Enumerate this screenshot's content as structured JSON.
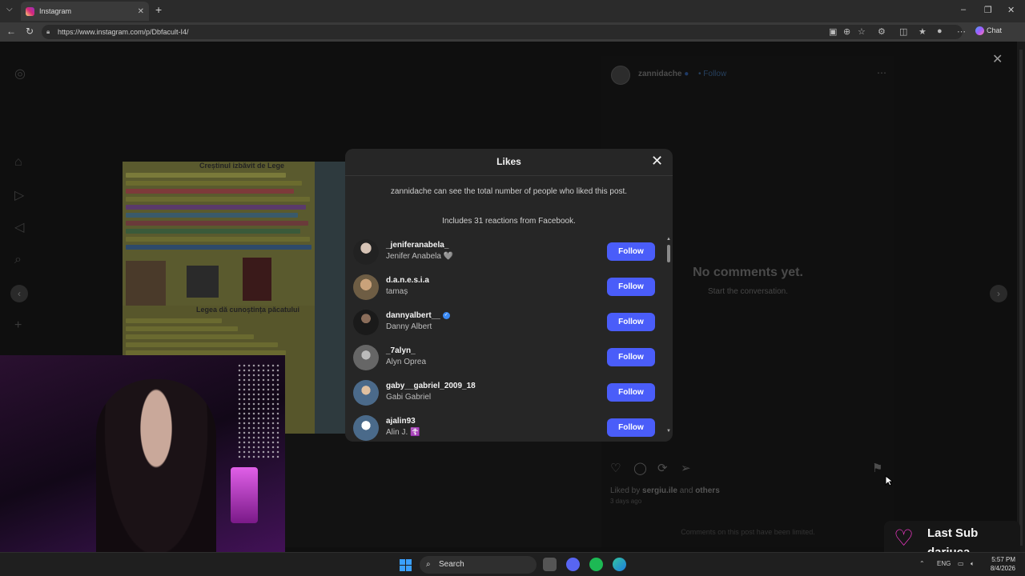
{
  "browser": {
    "tab_title": "Instagram",
    "url": "https://www.instagram.com/p/Dbfacult-I4/",
    "chat_label": "Chat"
  },
  "post": {
    "author": "zannidache",
    "follow_label": "Follow",
    "no_comments_title": "No comments yet.",
    "no_comments_sub": "Start the conversation.",
    "liked_by_prefix": "Liked by",
    "liked_by_user": "sergiu.ile",
    "liked_by_and": "and",
    "liked_by_others": "others",
    "time_ago": "3 days ago",
    "comments_limited": "Comments on this post have been limited.",
    "collage_title": "Creștinul izbăvit de Lege",
    "collage_subtitle": "Legea dă cunoștința păcatului"
  },
  "likes_modal": {
    "title": "Likes",
    "note": "zannidache can see the total number of people who liked this post.",
    "facebook_note": "Includes 31 reactions from Facebook.",
    "users": [
      {
        "username": "_jeniferanabela_",
        "fullname": "Jenifer Anabela 🩶",
        "verified": false,
        "button": "Follow"
      },
      {
        "username": "d.a.n.e.s.i.a",
        "fullname": "tamaș",
        "verified": false,
        "button": "Follow"
      },
      {
        "username": "dannyalbert__",
        "fullname": "Danny Albert",
        "verified": true,
        "button": "Follow"
      },
      {
        "username": "_7alyn_",
        "fullname": "Alyn Oprea",
        "verified": false,
        "button": "Follow"
      },
      {
        "username": "gaby__gabriel_2009_18",
        "fullname": "Gabi Gabriel",
        "verified": false,
        "button": "Follow"
      },
      {
        "username": "ajalin93",
        "fullname": "Alin J. ☦️",
        "verified": false,
        "button": "Follow"
      }
    ]
  },
  "stream_overlay": {
    "title": "Last Sub",
    "name": "dariuca"
  },
  "taskbar": {
    "search_label": "Search",
    "language": "ENG",
    "time": "5:57 PM",
    "date": "8/4/2026"
  },
  "colors": {
    "follow_button": "#4a5df9",
    "modal_bg": "#262626",
    "overlay_heart": "#ff3bd2"
  }
}
